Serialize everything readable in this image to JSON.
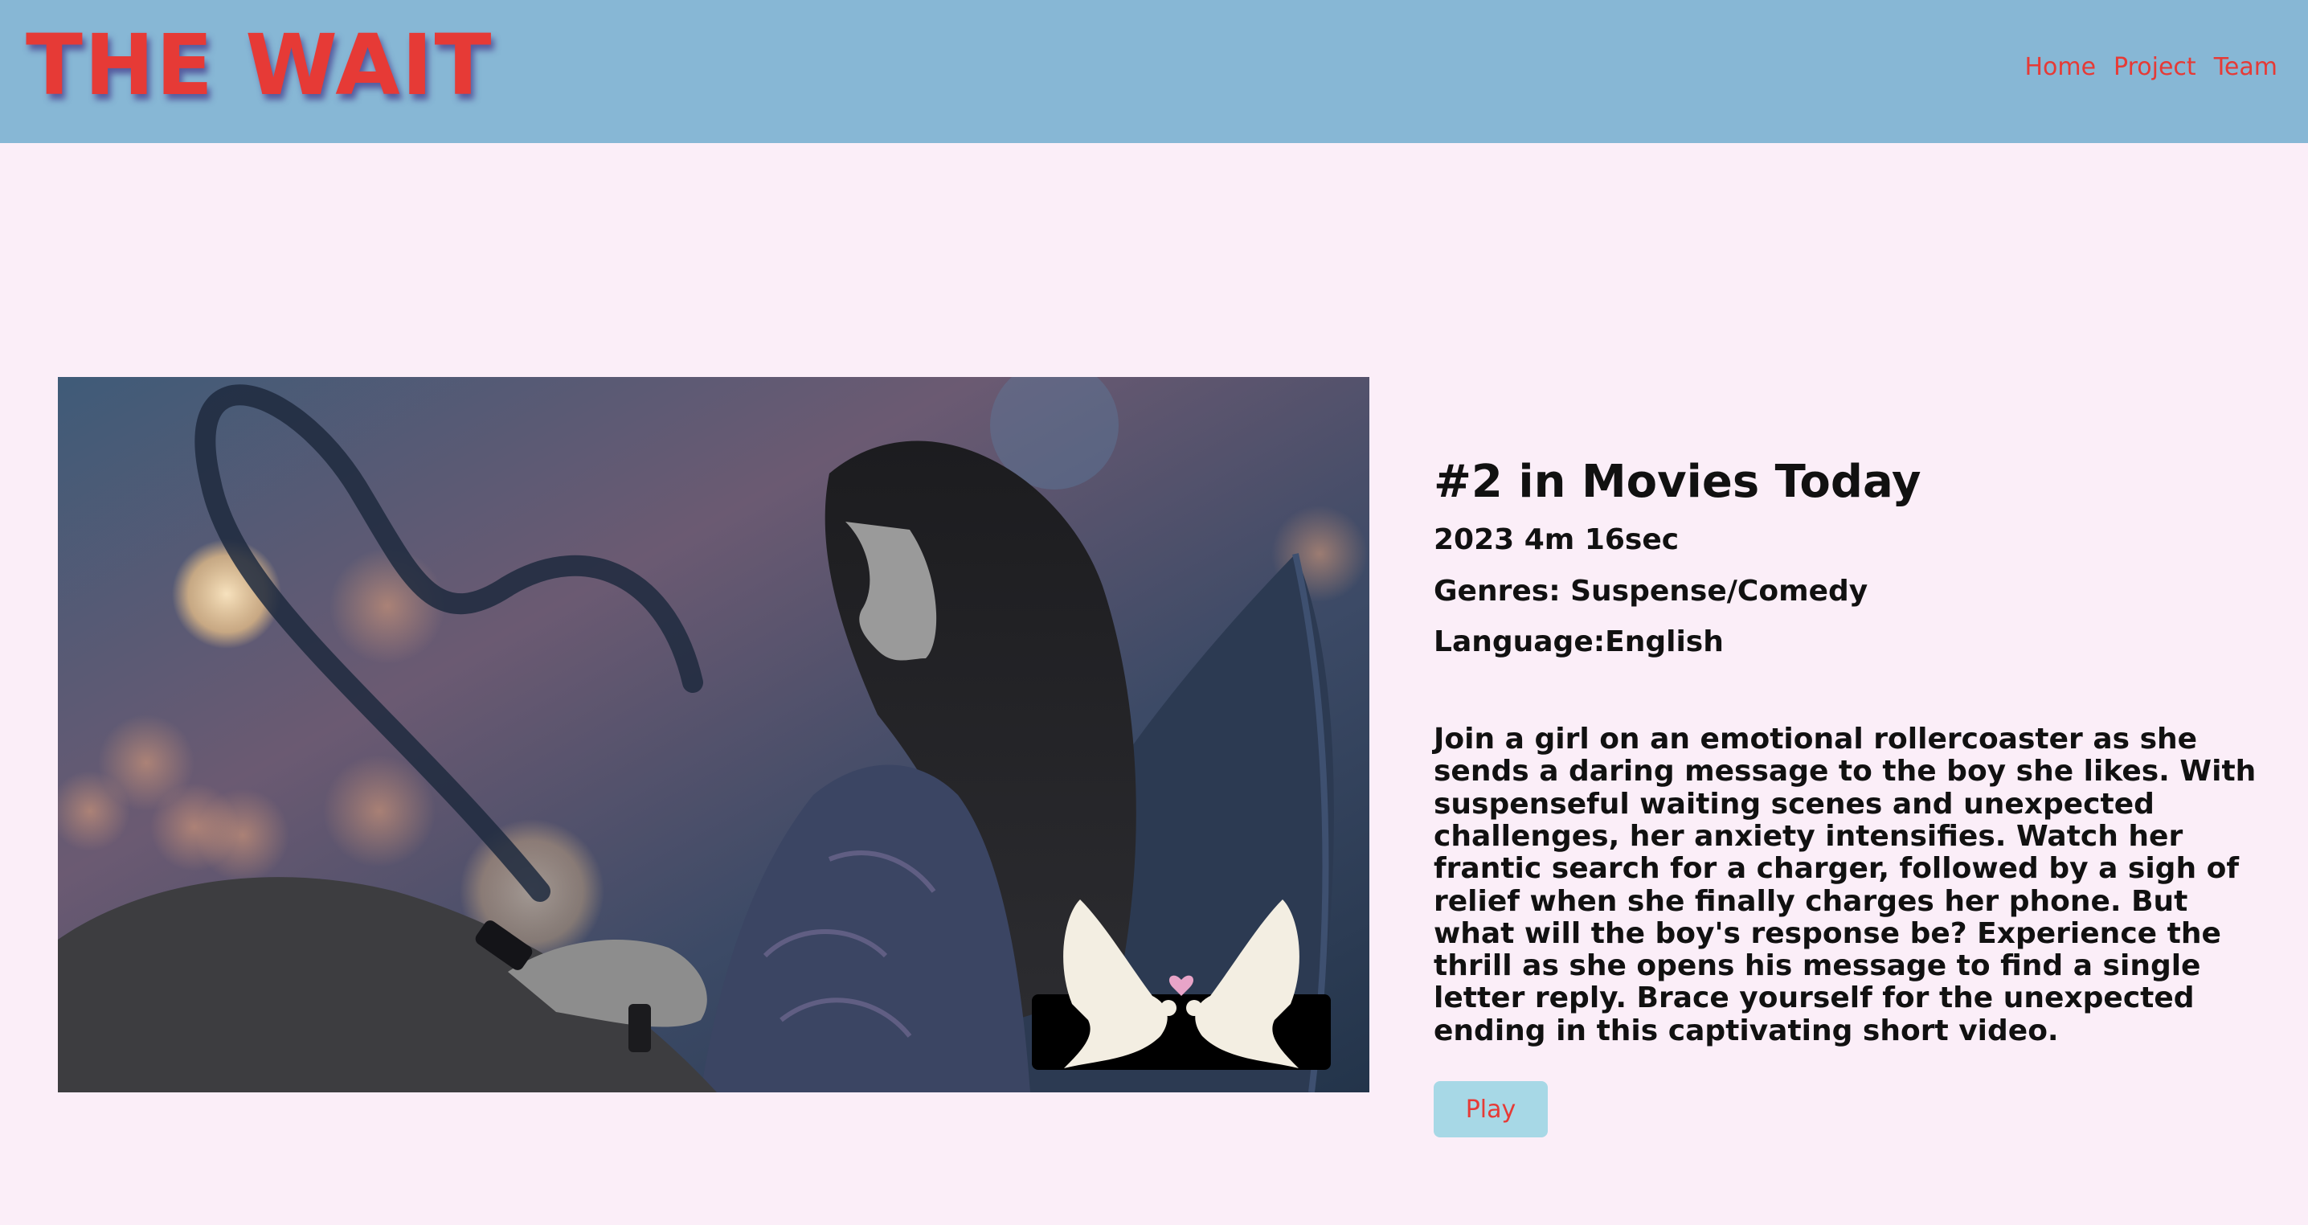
{
  "header": {
    "logo": "THE WAIT",
    "nav": [
      "Home",
      "Project",
      "Team"
    ]
  },
  "movie": {
    "rank": "#2 in Movies Today",
    "year_runtime": "2023 4m 16sec",
    "genres": "Genres: Suspense/Comedy",
    "language": "Language:English",
    "description": "Join a girl on an emotional rollercoaster as she sends a daring message to the boy she likes. With suspenseful waiting scenes and unexpected challenges, her anxiety intensifies. Watch her frantic search for a charger, followed by a sigh of relief when she finally charges her phone. But what will the boy's response be? Experience the thrill as she opens his message to find a single letter reply. Brace yourself for the unexpected ending in this captivating short video.",
    "play_label": "Play"
  },
  "colors": {
    "header_bg": "#87b7d5",
    "page_bg": "#fbeef8",
    "accent": "#e63a36",
    "button_bg": "#a7d8e6"
  }
}
